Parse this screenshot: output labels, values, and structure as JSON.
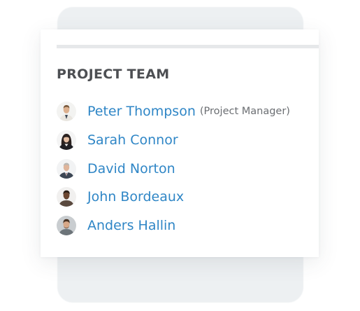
{
  "panel": {
    "title": "PROJECT TEAM"
  },
  "members": [
    {
      "name": "Peter Thompson",
      "role": "(Project Manager)",
      "avatar_icon": "person-photo-icon"
    },
    {
      "name": "Sarah Connor",
      "role": "",
      "avatar_icon": "person-photo-icon"
    },
    {
      "name": "David Norton",
      "role": "",
      "avatar_icon": "person-photo-icon"
    },
    {
      "name": "John Bordeaux",
      "role": "",
      "avatar_icon": "person-photo-icon"
    },
    {
      "name": "Anders Hallin",
      "role": "",
      "avatar_icon": "person-photo-icon"
    }
  ],
  "colors": {
    "link": "#2f86c6",
    "title": "#4d4f53",
    "role": "#6b6e72",
    "backdrop": "#edf0f2"
  }
}
